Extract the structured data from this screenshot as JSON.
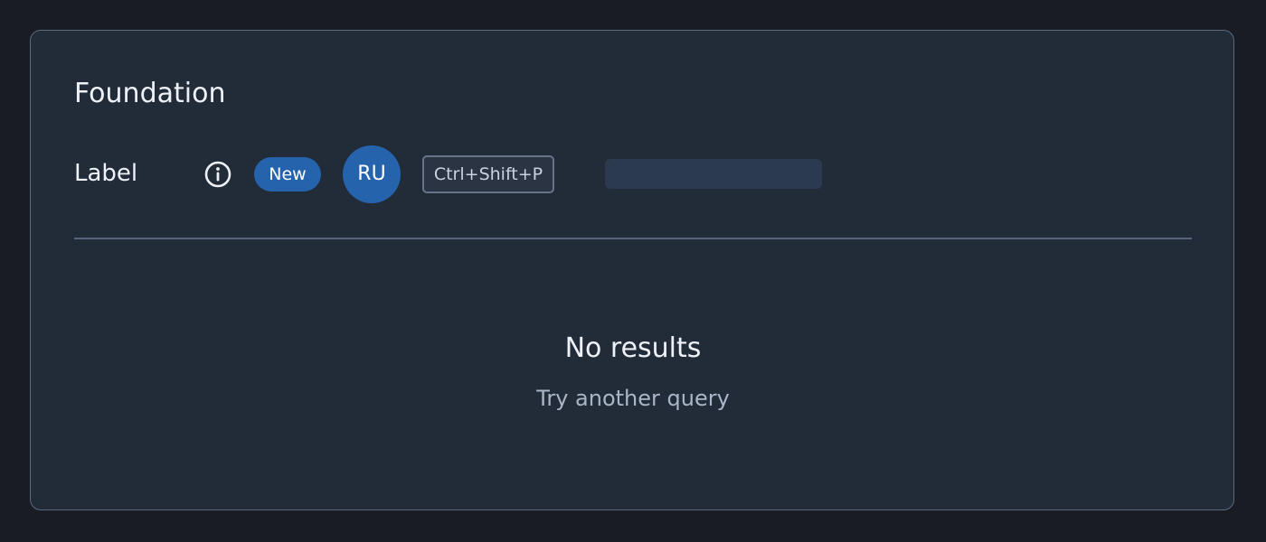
{
  "card": {
    "title": "Foundation"
  },
  "row": {
    "label": "Label",
    "info_icon": "info-circle-icon",
    "badge": "New",
    "avatar_initials": "RU",
    "shortcut": "Ctrl+Shift+P"
  },
  "empty_state": {
    "title": "No results",
    "subtitle": "Try another query"
  },
  "colors": {
    "page_bg": "#191d23",
    "card_bg": "#222b38",
    "card_border": "#5b6a80",
    "accent": "#2563ad",
    "skeleton": "#2c3a4f"
  }
}
